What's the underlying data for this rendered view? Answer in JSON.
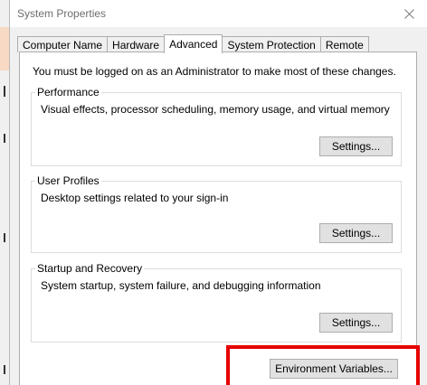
{
  "window": {
    "title": "System Properties"
  },
  "tabs": [
    {
      "label": "Computer Name",
      "active": false
    },
    {
      "label": "Hardware",
      "active": false
    },
    {
      "label": "Advanced",
      "active": true
    },
    {
      "label": "System Protection",
      "active": false
    },
    {
      "label": "Remote",
      "active": false
    }
  ],
  "advanced": {
    "notice": "You must be logged on as an Administrator to make most of these changes.",
    "performance": {
      "title": "Performance",
      "description": "Visual effects, processor scheduling, memory usage, and virtual memory",
      "button_label": "Settings..."
    },
    "user_profiles": {
      "title": "User Profiles",
      "description": "Desktop settings related to your sign-in",
      "button_label": "Settings..."
    },
    "startup_recovery": {
      "title": "Startup and Recovery",
      "description": "System startup, system failure, and debugging information",
      "button_label": "Settings..."
    },
    "environment_button_label": "Environment Variables..."
  },
  "colors": {
    "highlight": "#e60000",
    "window_bg": "#f0f0f0",
    "panel_bg": "#ffffff",
    "button_bg": "#e1e1e1"
  }
}
